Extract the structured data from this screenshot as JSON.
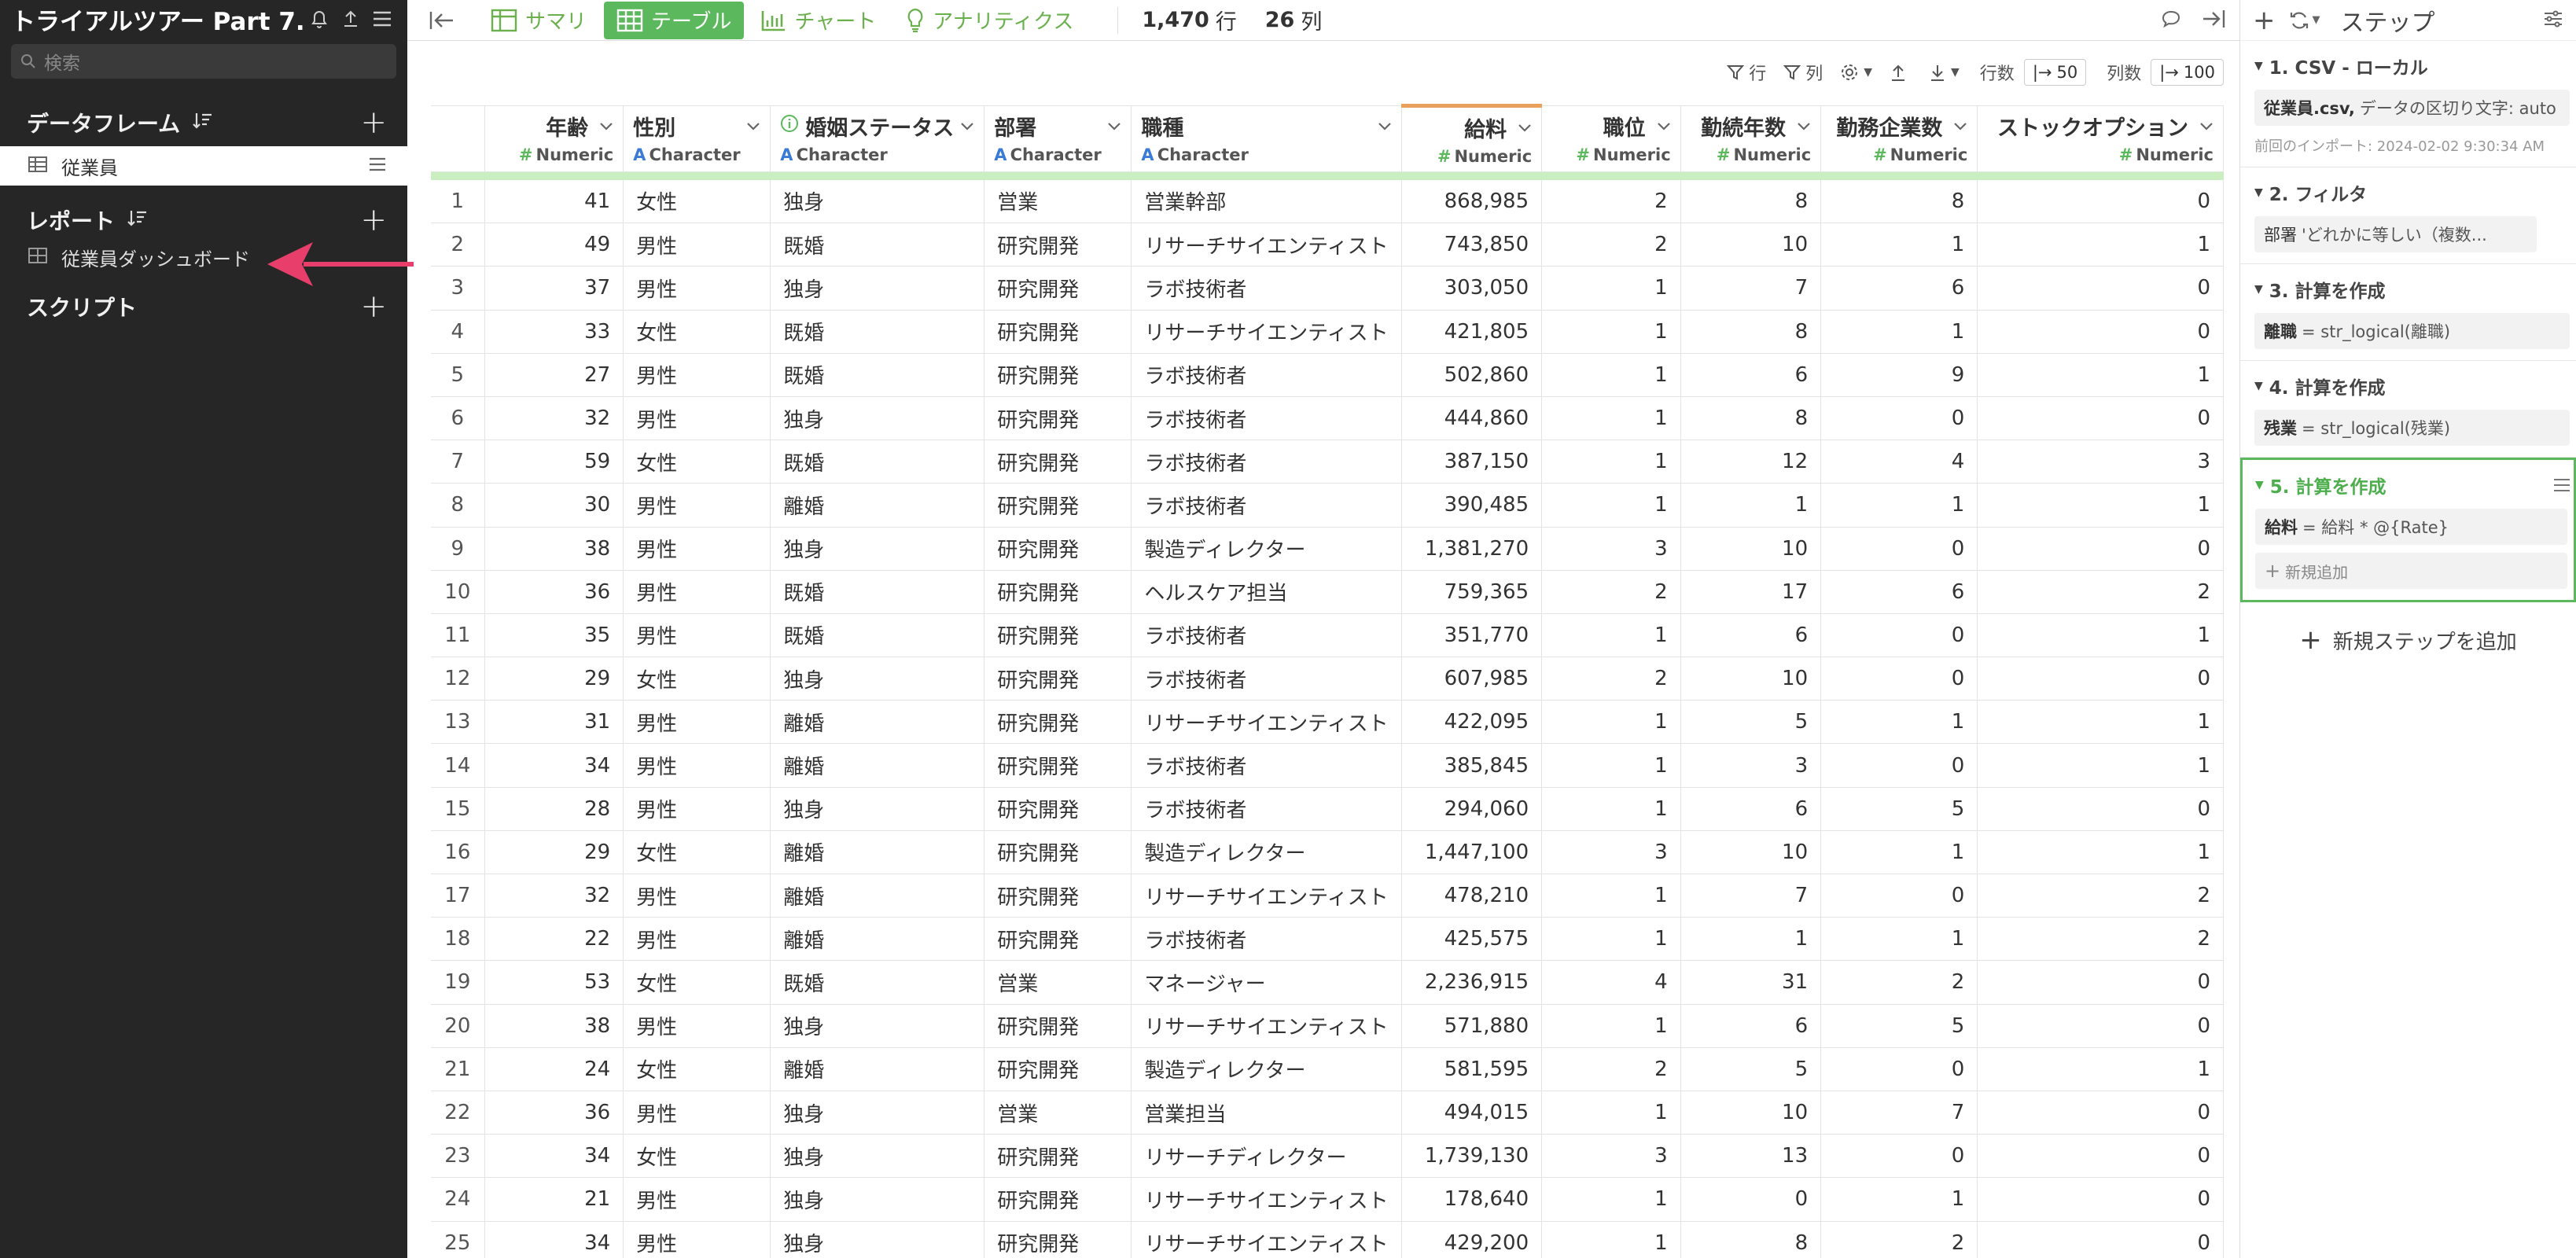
{
  "sidebar": {
    "title": "トライアルツアー Part 7...",
    "search_placeholder": "検索",
    "sections": {
      "dataframes": {
        "label": "データフレーム",
        "items": [
          {
            "label": "従業員"
          }
        ]
      },
      "reports": {
        "label": "レポート",
        "items": [
          {
            "label": "従業員ダッシュボード"
          }
        ]
      },
      "scripts": {
        "label": "スクリプト"
      }
    }
  },
  "toolbar": {
    "tabs": {
      "summary": "サマリ",
      "table": "テーブル",
      "chart": "チャート",
      "analytics": "アナリティクス"
    },
    "row_count": "1,470",
    "row_unit": "行",
    "col_count": "26",
    "col_unit": "列"
  },
  "subbar": {
    "row_filter": "行",
    "col_filter": "列",
    "rows_label": "行数",
    "rows_value": "50",
    "cols_label": "列数",
    "cols_value": "100"
  },
  "table": {
    "columns": [
      {
        "name": "年齢",
        "type": "Numeric",
        "kind": "num"
      },
      {
        "name": "性別",
        "type": "Character",
        "kind": "chr"
      },
      {
        "name": "婚姻ステータス",
        "type": "Character",
        "kind": "chr"
      },
      {
        "name": "部署",
        "type": "Character",
        "kind": "chr"
      },
      {
        "name": "職種",
        "type": "Character",
        "kind": "chr"
      },
      {
        "name": "給料",
        "type": "Numeric",
        "kind": "num"
      },
      {
        "name": "職位",
        "type": "Numeric",
        "kind": "num"
      },
      {
        "name": "勤続年数",
        "type": "Numeric",
        "kind": "num"
      },
      {
        "name": "勤務企業数",
        "type": "Numeric",
        "kind": "num"
      },
      {
        "name": "ストックオプション",
        "type": "Numeric",
        "kind": "num"
      }
    ],
    "rows": [
      [
        "1",
        "41",
        "女性",
        "独身",
        "営業",
        "営業幹部",
        "868,985",
        "2",
        "8",
        "8",
        "0"
      ],
      [
        "2",
        "49",
        "男性",
        "既婚",
        "研究開発",
        "リサーチサイエンティスト",
        "743,850",
        "2",
        "10",
        "1",
        "1"
      ],
      [
        "3",
        "37",
        "男性",
        "独身",
        "研究開発",
        "ラボ技術者",
        "303,050",
        "1",
        "7",
        "6",
        "0"
      ],
      [
        "4",
        "33",
        "女性",
        "既婚",
        "研究開発",
        "リサーチサイエンティスト",
        "421,805",
        "1",
        "8",
        "1",
        "0"
      ],
      [
        "5",
        "27",
        "男性",
        "既婚",
        "研究開発",
        "ラボ技術者",
        "502,860",
        "1",
        "6",
        "9",
        "1"
      ],
      [
        "6",
        "32",
        "男性",
        "独身",
        "研究開発",
        "ラボ技術者",
        "444,860",
        "1",
        "8",
        "0",
        "0"
      ],
      [
        "7",
        "59",
        "女性",
        "既婚",
        "研究開発",
        "ラボ技術者",
        "387,150",
        "1",
        "12",
        "4",
        "3"
      ],
      [
        "8",
        "30",
        "男性",
        "離婚",
        "研究開発",
        "ラボ技術者",
        "390,485",
        "1",
        "1",
        "1",
        "1"
      ],
      [
        "9",
        "38",
        "男性",
        "独身",
        "研究開発",
        "製造ディレクター",
        "1,381,270",
        "3",
        "10",
        "0",
        "0"
      ],
      [
        "10",
        "36",
        "男性",
        "既婚",
        "研究開発",
        "ヘルスケア担当",
        "759,365",
        "2",
        "17",
        "6",
        "2"
      ],
      [
        "11",
        "35",
        "男性",
        "既婚",
        "研究開発",
        "ラボ技術者",
        "351,770",
        "1",
        "6",
        "0",
        "1"
      ],
      [
        "12",
        "29",
        "女性",
        "独身",
        "研究開発",
        "ラボ技術者",
        "607,985",
        "2",
        "10",
        "0",
        "0"
      ],
      [
        "13",
        "31",
        "男性",
        "離婚",
        "研究開発",
        "リサーチサイエンティスト",
        "422,095",
        "1",
        "5",
        "1",
        "1"
      ],
      [
        "14",
        "34",
        "男性",
        "離婚",
        "研究開発",
        "ラボ技術者",
        "385,845",
        "1",
        "3",
        "0",
        "1"
      ],
      [
        "15",
        "28",
        "男性",
        "独身",
        "研究開発",
        "ラボ技術者",
        "294,060",
        "1",
        "6",
        "5",
        "0"
      ],
      [
        "16",
        "29",
        "女性",
        "離婚",
        "研究開発",
        "製造ディレクター",
        "1,447,100",
        "3",
        "10",
        "1",
        "1"
      ],
      [
        "17",
        "32",
        "男性",
        "離婚",
        "研究開発",
        "リサーチサイエンティスト",
        "478,210",
        "1",
        "7",
        "0",
        "2"
      ],
      [
        "18",
        "22",
        "男性",
        "離婚",
        "研究開発",
        "ラボ技術者",
        "425,575",
        "1",
        "1",
        "1",
        "2"
      ],
      [
        "19",
        "53",
        "女性",
        "既婚",
        "営業",
        "マネージャー",
        "2,236,915",
        "4",
        "31",
        "2",
        "0"
      ],
      [
        "20",
        "38",
        "男性",
        "独身",
        "研究開発",
        "リサーチサイエンティスト",
        "571,880",
        "1",
        "6",
        "5",
        "0"
      ],
      [
        "21",
        "24",
        "女性",
        "離婚",
        "研究開発",
        "製造ディレクター",
        "581,595",
        "2",
        "5",
        "0",
        "1"
      ],
      [
        "22",
        "36",
        "男性",
        "独身",
        "営業",
        "営業担当",
        "494,015",
        "1",
        "10",
        "7",
        "0"
      ],
      [
        "23",
        "34",
        "女性",
        "独身",
        "研究開発",
        "リサーチディレクター",
        "1,739,130",
        "3",
        "13",
        "0",
        "0"
      ],
      [
        "24",
        "21",
        "男性",
        "独身",
        "研究開発",
        "リサーチサイエンティスト",
        "178,640",
        "1",
        "0",
        "1",
        "0"
      ],
      [
        "25",
        "34",
        "男性",
        "独身",
        "研究開発",
        "リサーチサイエンティスト",
        "429,200",
        "1",
        "8",
        "2",
        "0"
      ]
    ]
  },
  "steps_panel": {
    "title": "ステップ",
    "add_step": "新規ステップを追加",
    "steps": [
      {
        "title": "1. CSV - ローカル",
        "lines": [
          {
            "bold": "従業員.csv,",
            "text": "データの区切り文字: auto"
          }
        ],
        "sub": "前回のインポート: 2024-02-02 9:30:34 AM"
      },
      {
        "title": "2. フィルタ",
        "lines": [
          {
            "bold": "部署",
            "text": "'どれかに等しい（複数..."
          }
        ]
      },
      {
        "title": "3. 計算を作成",
        "lines": [
          {
            "bold": "離職",
            "text": "= str_logical(離職)"
          }
        ]
      },
      {
        "title": "4. 計算を作成",
        "lines": [
          {
            "bold": "残業",
            "text": "= str_logical(残業)"
          }
        ]
      },
      {
        "title": "5. 計算を作成",
        "lines": [
          {
            "bold": "給料",
            "text": "= 給料 * @{Rate}"
          }
        ],
        "add_new": "新規追加"
      }
    ]
  }
}
